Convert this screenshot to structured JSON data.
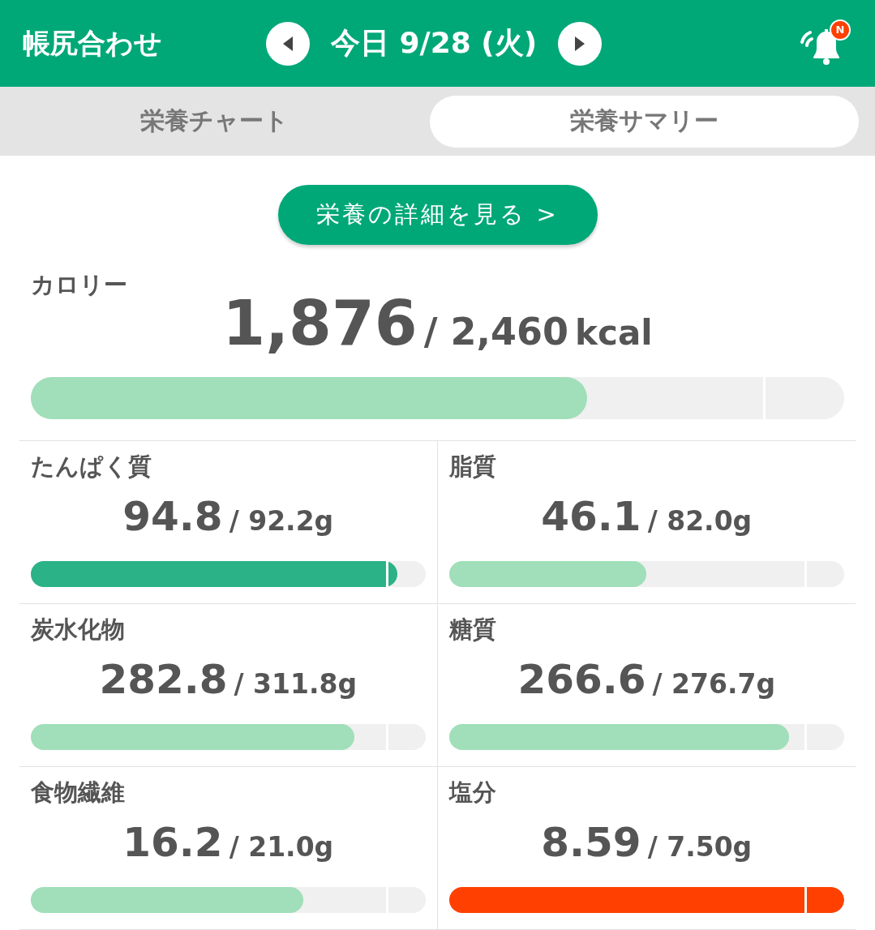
{
  "header": {
    "title": "帳尻合わせ",
    "date": "今日 9/28 (火)",
    "badge": "N"
  },
  "tabs": [
    {
      "label": "栄養チャート",
      "selected": false
    },
    {
      "label": "栄養サマリー",
      "selected": true
    }
  ],
  "detail_button": "栄養の詳細を見る >",
  "calorie": {
    "label": "カロリー",
    "value": "1,876",
    "target": "/ 2,460",
    "unit": "kcal",
    "level": 0.684,
    "color": "#a0dfb9"
  },
  "nutrients": [
    {
      "label": "たんぱく質",
      "value": "94.8",
      "target": "/ 92.2g",
      "level": 0.93,
      "color": "#2bb286"
    },
    {
      "label": "脂質",
      "value": "46.1",
      "target": "/ 82.0g",
      "level": 0.5,
      "color": "#a0dfb9"
    },
    {
      "label": "炭水化物",
      "value": "282.8",
      "target": "/ 311.8g",
      "level": 0.82,
      "color": "#a0dfb9"
    },
    {
      "label": "糖質",
      "value": "266.6",
      "target": "/ 276.7g",
      "level": 0.86,
      "color": "#a0dfb9"
    },
    {
      "label": "食物繊維",
      "value": "16.2",
      "target": "/ 21.0g",
      "level": 0.69,
      "color": "#a0dfb9"
    },
    {
      "label": "塩分",
      "value": "8.59",
      "target": "/ 7.50g",
      "level": 1,
      "color": "#ff4000"
    }
  ]
}
